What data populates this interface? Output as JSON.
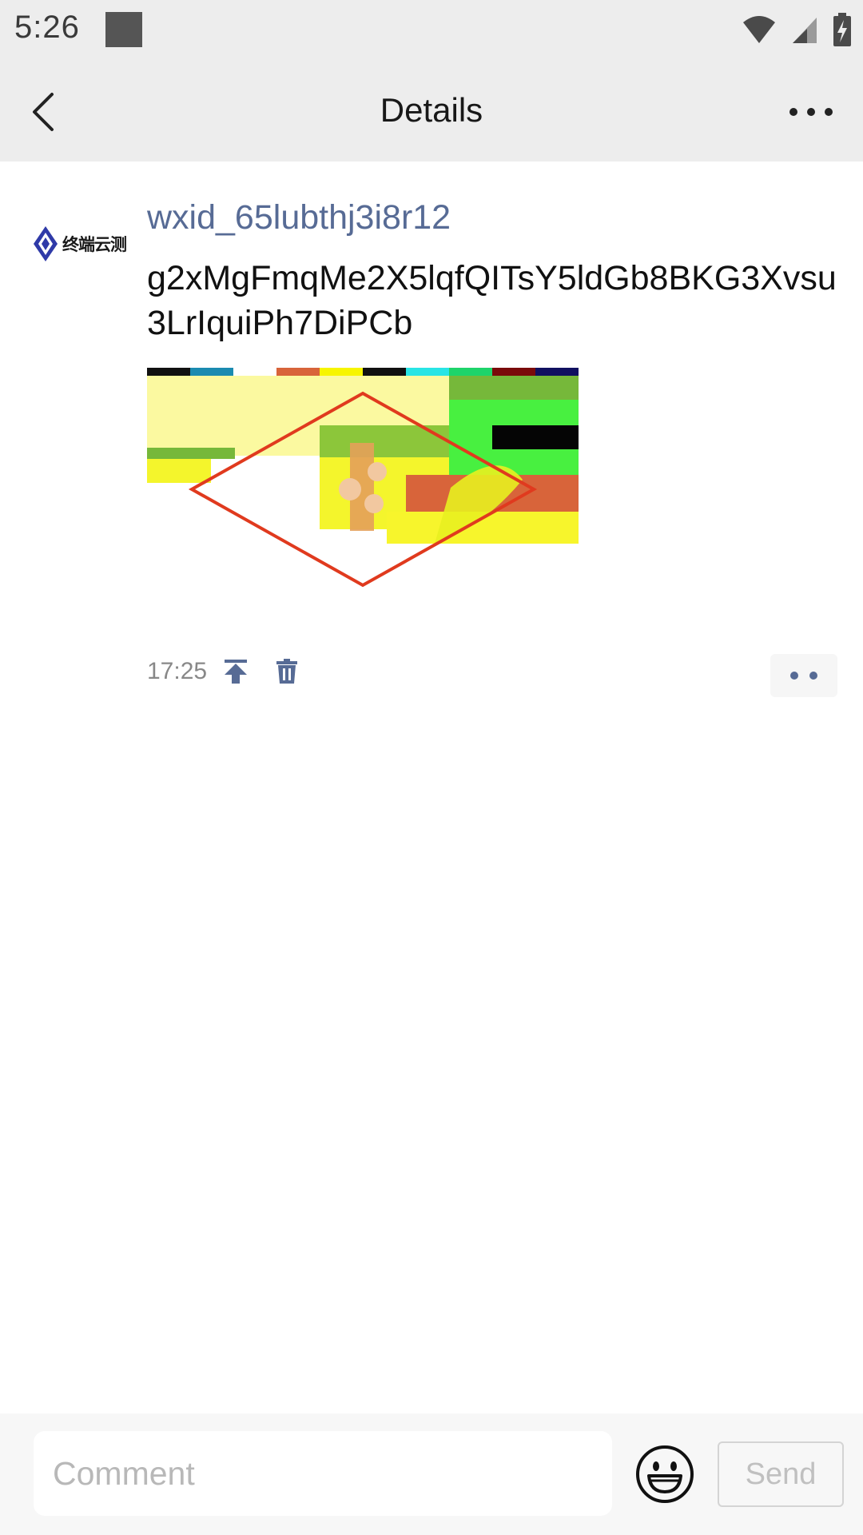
{
  "status_bar": {
    "time": "5:26",
    "icons": [
      "wifi-icon",
      "signal-icon",
      "battery-charging-icon"
    ]
  },
  "app_bar": {
    "title": "Details",
    "back_icon": "chevron-left-icon",
    "more_icon": "more-horizontal-icon"
  },
  "post": {
    "avatar_text": "终端云测",
    "username": "wxid_65lubthj3i8r12",
    "text": "g2xMgFmqMe2X5lqfQITsY5ldGb8BKG3Xvsu3LrIquiPh7DiPCb",
    "time": "17:25",
    "pin_icon": "pin-top-icon",
    "delete_icon": "trash-icon",
    "action_icon": "two-dots-icon"
  },
  "comment_bar": {
    "placeholder": "Comment",
    "emoji_icon": "smiley-icon",
    "send_label": "Send"
  },
  "colors": {
    "bar_background": "#ededed",
    "username": "#576b95",
    "icon_accent": "#576b95",
    "image_outline": "#e03a1e"
  }
}
